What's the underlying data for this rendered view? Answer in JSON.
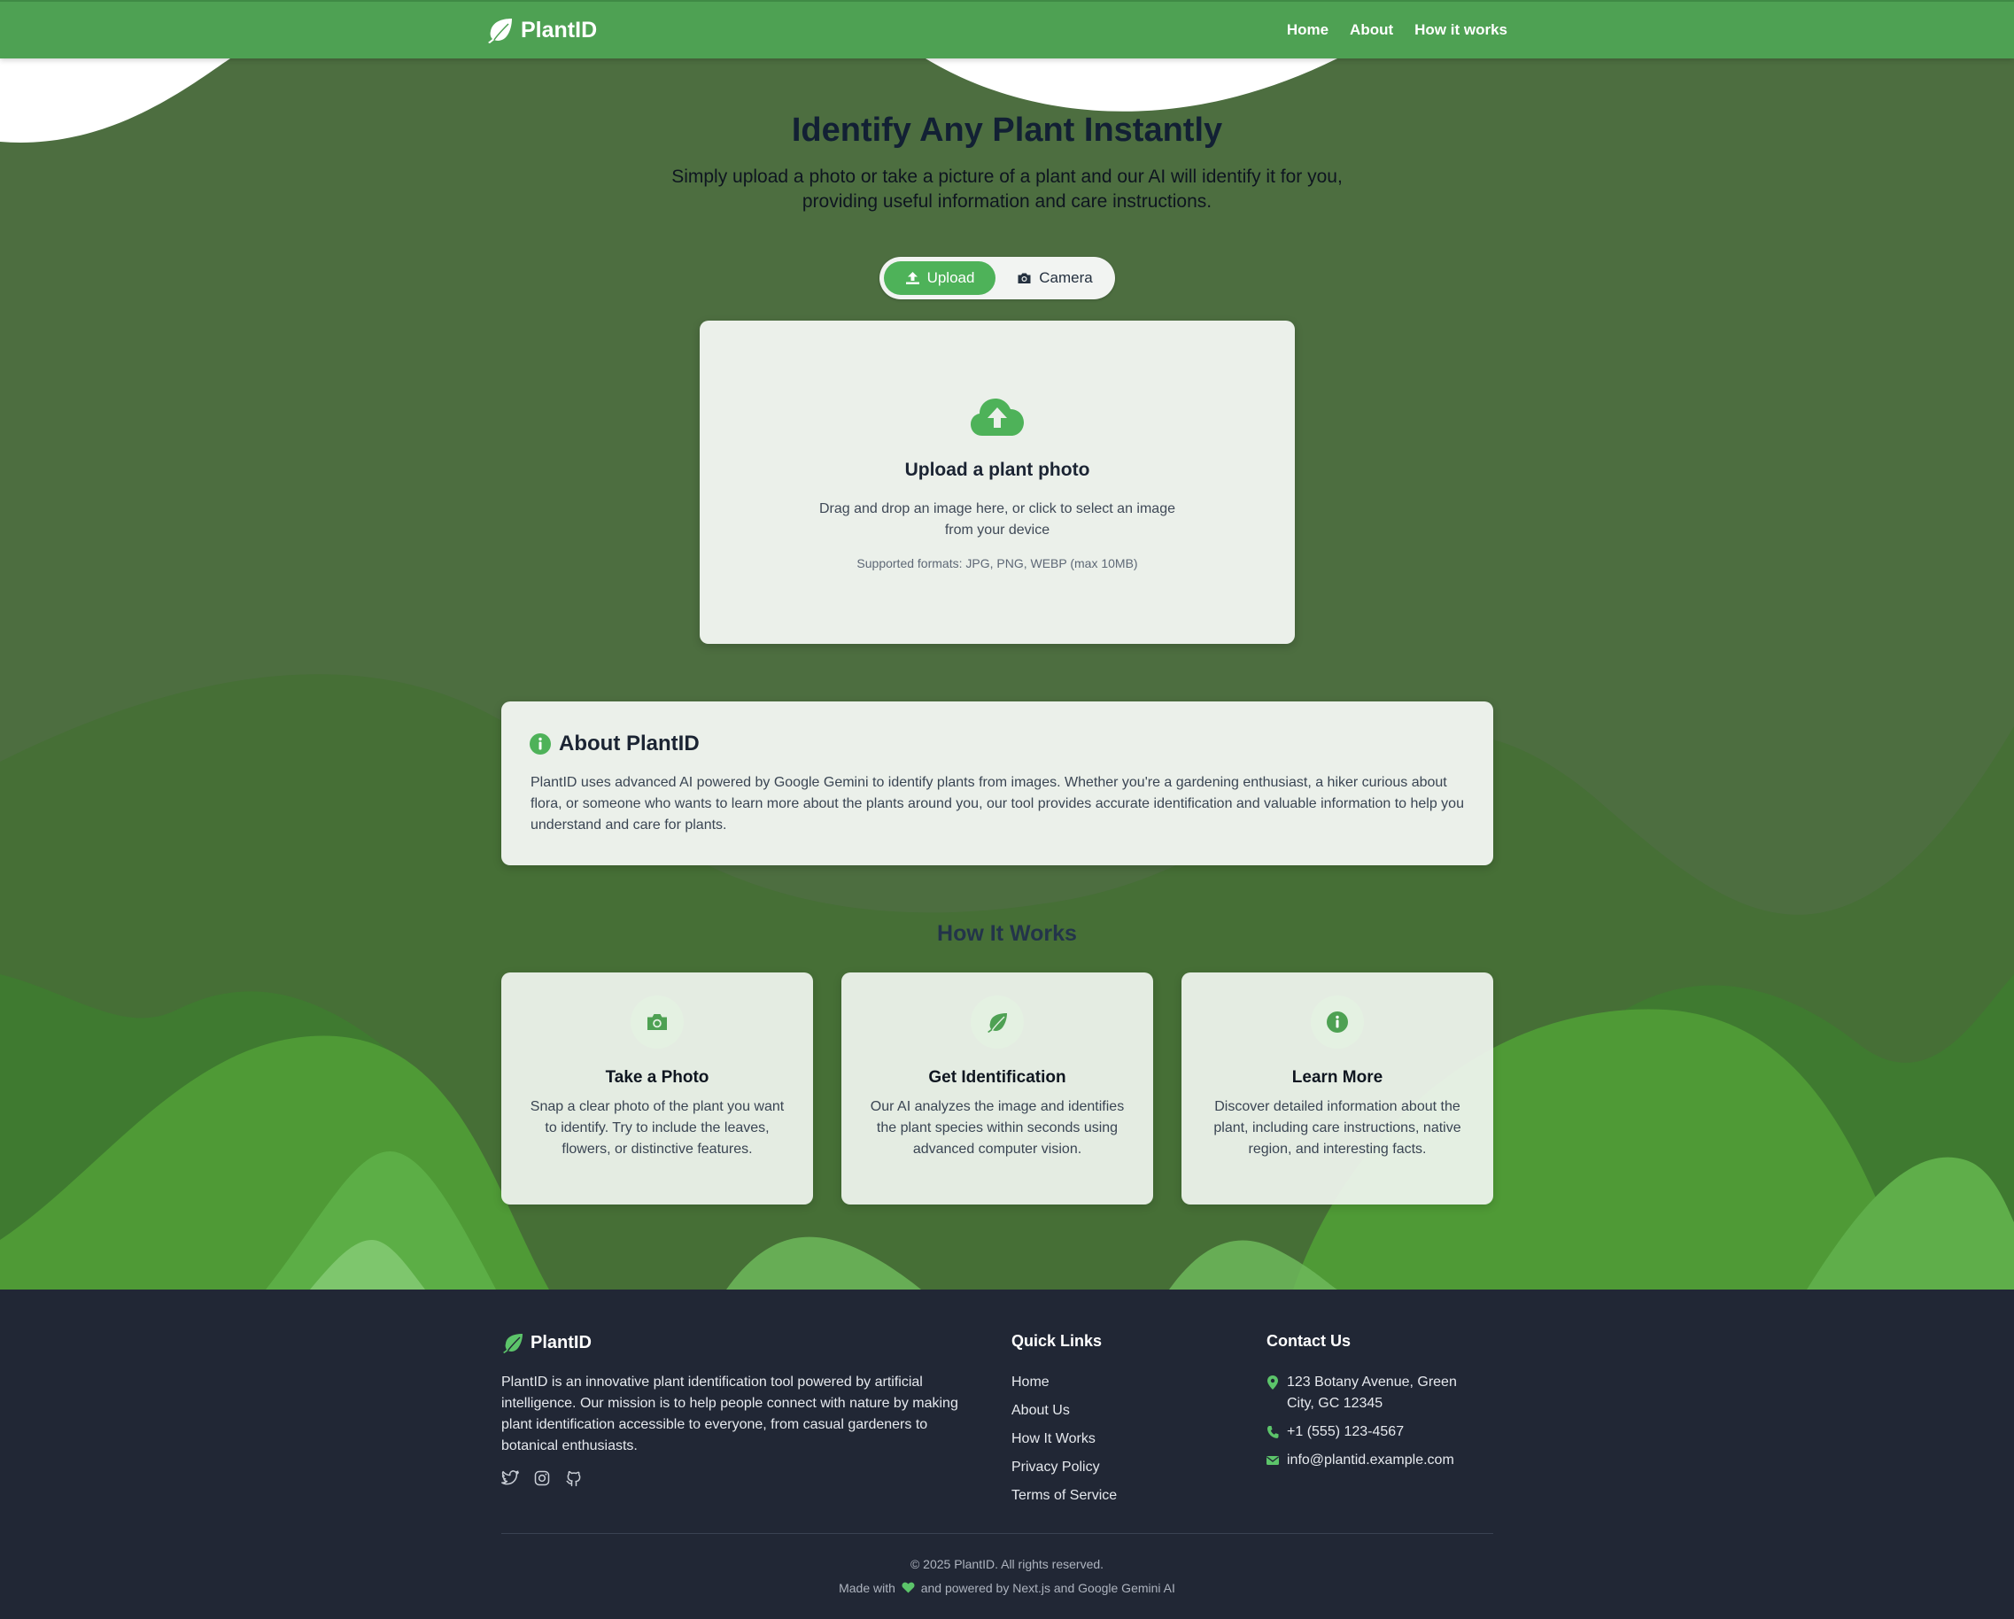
{
  "colors": {
    "nav": "#4ea153",
    "accent": "#4eb259",
    "hero_bg": "#4d6e40",
    "footer_bg": "#212735"
  },
  "nav": {
    "brand": "PlantID",
    "links": [
      "Home",
      "About",
      "How it works"
    ]
  },
  "hero": {
    "title": "Identify Any Plant Instantly",
    "subtitle": "Simply upload a photo or take a picture of a plant and our AI will identify it for you, providing useful information and care instructions."
  },
  "mode_toggle": {
    "upload_label": "Upload",
    "camera_label": "Camera",
    "active": "Upload"
  },
  "upload": {
    "icon": "cloud-upload-icon",
    "title": "Upload a plant photo",
    "description": "Drag and drop an image here, or click to select an image from your device",
    "formats": "Supported formats: JPG, PNG, WEBP (max 10MB)"
  },
  "about": {
    "icon": "info-icon",
    "title": "About PlantID",
    "text": "PlantID uses advanced AI powered by Google Gemini to identify plants from images. Whether you're a gardening enthusiast, a hiker curious about flora, or someone who wants to learn more about the plants around you, our tool provides accurate identification and valuable information to help you understand and care for plants."
  },
  "how_it_works": {
    "title": "How It Works",
    "cards": [
      {
        "icon": "camera-icon",
        "title": "Take a Photo",
        "text": "Snap a clear photo of the plant you want to identify. Try to include the leaves, flowers, or distinctive features."
      },
      {
        "icon": "leaf-icon",
        "title": "Get Identification",
        "text": "Our AI analyzes the image and identifies the plant species within seconds using advanced computer vision."
      },
      {
        "icon": "info-icon",
        "title": "Learn More",
        "text": "Discover detailed information about the plant, including care instructions, native region, and interesting facts."
      }
    ]
  },
  "footer": {
    "brand": "PlantID",
    "description": "PlantID is an innovative plant identification tool powered by artificial intelligence. Our mission is to help people connect with nature by making plant identification accessible to everyone, from casual gardeners to botanical enthusiasts.",
    "social": [
      "twitter-icon",
      "instagram-icon",
      "github-icon"
    ],
    "quick_links_title": "Quick Links",
    "quick_links": [
      "Home",
      "About Us",
      "How It Works",
      "Privacy Policy",
      "Terms of Service"
    ],
    "contact_title": "Contact Us",
    "address": "123 Botany Avenue, Green City, GC 12345",
    "phone": "+1 (555) 123-4567",
    "email": "info@plantid.example.com",
    "copyright": "© 2025 PlantID. All rights reserved.",
    "made_with_prefix": "Made with",
    "made_with_suffix": "and powered by Next.js and Google Gemini AI"
  }
}
